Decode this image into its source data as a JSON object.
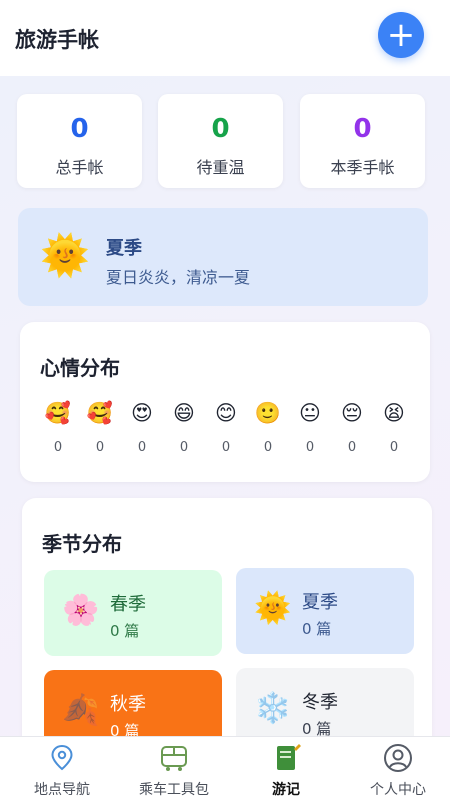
{
  "header": {
    "title": "旅游手帐",
    "add_label": "+"
  },
  "stats": [
    {
      "value": "0",
      "label": "总手帐",
      "color": "#2563eb"
    },
    {
      "value": "0",
      "label": "待重温",
      "color": "#16a34a"
    },
    {
      "value": "0",
      "label": "本季手帐",
      "color": "#9333ea"
    }
  ],
  "current_season": {
    "icon": "🌞",
    "name": "夏季",
    "desc": "夏日炎炎，清凉一夏"
  },
  "mood": {
    "title": "心情分布",
    "items": [
      {
        "emoji": "🥰",
        "count": "0"
      },
      {
        "emoji": "🥰",
        "count": "0"
      },
      {
        "emoji": "😍",
        "count": "0"
      },
      {
        "emoji": "😄",
        "count": "0"
      },
      {
        "emoji": "😊",
        "count": "0"
      },
      {
        "emoji": "🙂",
        "count": "0"
      },
      {
        "emoji": "😐",
        "count": "0"
      },
      {
        "emoji": "😔",
        "count": "0"
      },
      {
        "emoji": "😫",
        "count": "0"
      }
    ]
  },
  "seasons": {
    "title": "季节分布",
    "items": [
      {
        "icon": "🌸",
        "name": "春季",
        "count": "0 篇",
        "bg": "#dcfce7",
        "fg": "#1f6b3a"
      },
      {
        "icon": "🌞",
        "name": "夏季",
        "count": "0 篇",
        "bg": "#dbe7fb",
        "fg": "#2c4a86"
      },
      {
        "icon": "🍂",
        "name": "秋季",
        "count": "0 篇",
        "bg": "#f97316",
        "fg": "#ffffff"
      },
      {
        "icon": "❄️",
        "name": "冬季",
        "count": "0 篇",
        "bg": "#f3f4f6",
        "fg": "#1f2430"
      }
    ]
  },
  "nav": [
    {
      "icon": "location-pin-icon",
      "label": "地点导航",
      "active": false
    },
    {
      "icon": "bus-icon",
      "label": "乘车工具包",
      "active": false
    },
    {
      "icon": "notebook-icon",
      "label": "游记",
      "active": true
    },
    {
      "icon": "user-icon",
      "label": "个人中心",
      "active": false
    }
  ]
}
